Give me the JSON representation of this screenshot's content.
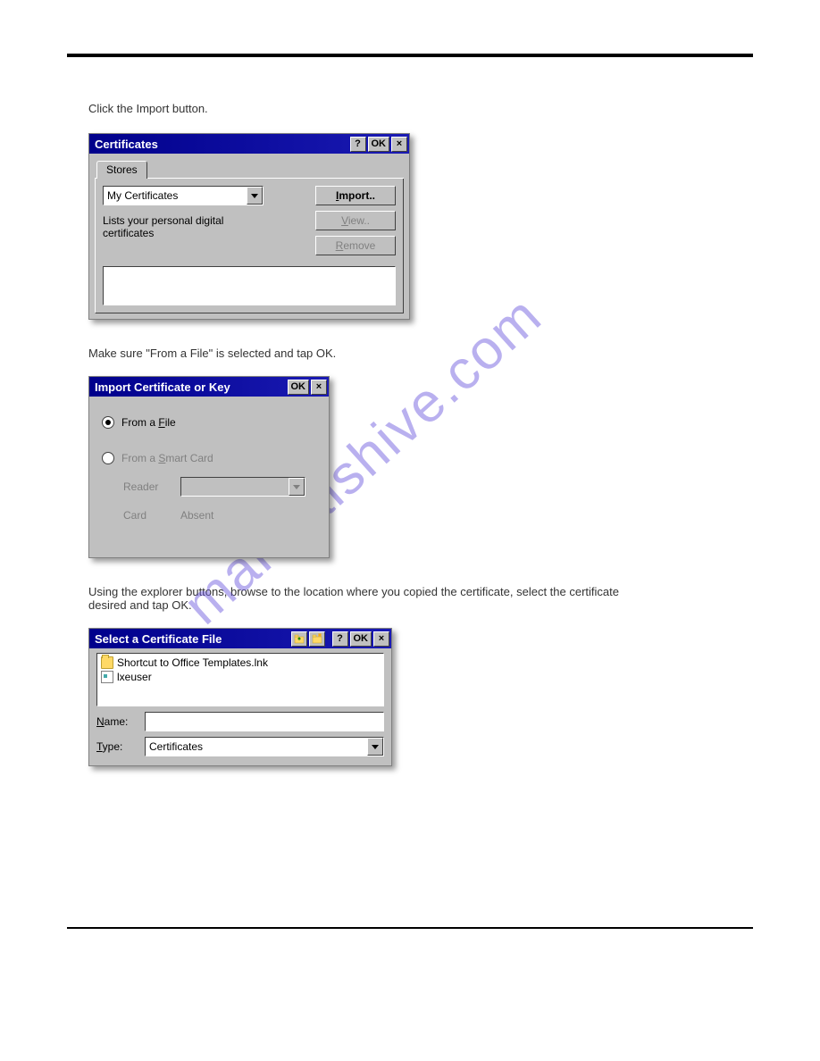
{
  "intro": "Click the Import button.",
  "watermark": "manualshive.com",
  "dialog1": {
    "title": "Certificates",
    "help": "?",
    "ok": "OK",
    "close": "×",
    "tab": "Stores",
    "combo_selected": "My Certificates",
    "desc": "Lists your personal digital certificates",
    "btn_import": "Import..",
    "btn_view": "View..",
    "btn_remove": "Remove"
  },
  "text2": "Make sure \"From a File\" is selected and tap OK.",
  "dialog2": {
    "title": "Import Certificate or Key",
    "ok": "OK",
    "close": "×",
    "radio_file": "From a File",
    "radio_smart": "From a Smart Card",
    "lbl_reader": "Reader",
    "lbl_card": "Card",
    "card_val": "Absent"
  },
  "text3": "Using the explorer buttons, browse to the location where you copied the certificate, select the certificate desired and tap OK.",
  "dialog3": {
    "title": "Select a Certificate File",
    "help": "?",
    "ok": "OK",
    "close": "×",
    "file1": "Shortcut to Office Templates.lnk",
    "file2": "lxeuser",
    "lbl_name": "Name:",
    "name_val": "",
    "lbl_type": "Type:",
    "type_val": "Certificates"
  }
}
